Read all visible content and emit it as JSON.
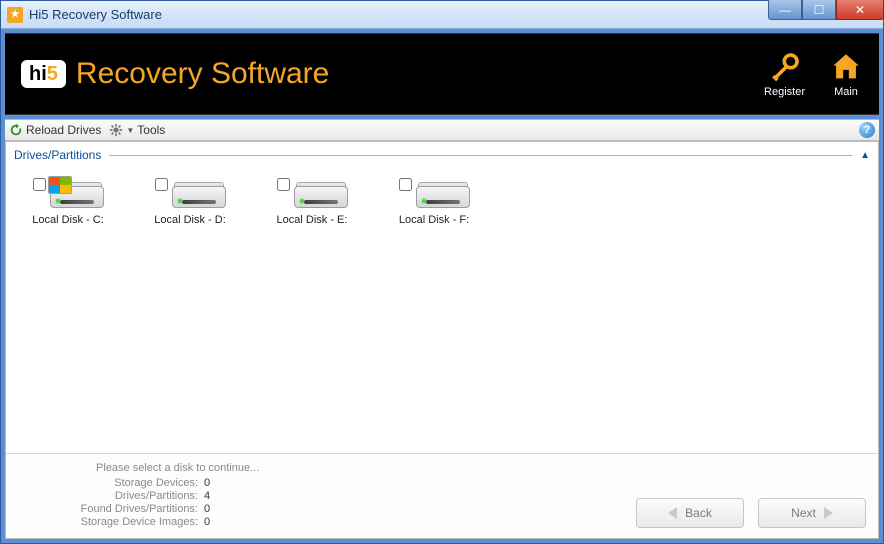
{
  "window": {
    "title": "Hi5 Recovery Software"
  },
  "header": {
    "logo_prefix": "hi",
    "logo_suffix": "5",
    "product_name": "Recovery Software",
    "register_label": "Register",
    "main_label": "Main"
  },
  "toolbar": {
    "reload_label": "Reload Drives",
    "tools_label": "Tools"
  },
  "section": {
    "title": "Drives/Partitions"
  },
  "drives": [
    {
      "label": "Local Disk - C:",
      "is_os": true,
      "checked": false
    },
    {
      "label": "Local Disk - D:",
      "is_os": false,
      "checked": false
    },
    {
      "label": "Local Disk - E:",
      "is_os": false,
      "checked": false
    },
    {
      "label": "Local Disk - F:",
      "is_os": false,
      "checked": false
    }
  ],
  "footer": {
    "hint": "Please select a disk to continue...",
    "stats": {
      "storage_devices_label": "Storage Devices:",
      "storage_devices_value": "0",
      "drives_partitions_label": "Drives/Partitions:",
      "drives_partitions_value": "4",
      "found_drives_label": "Found Drives/Partitions:",
      "found_drives_value": "0",
      "device_images_label": "Storage Device Images:",
      "device_images_value": "0"
    },
    "back_label": "Back",
    "next_label": "Next"
  }
}
